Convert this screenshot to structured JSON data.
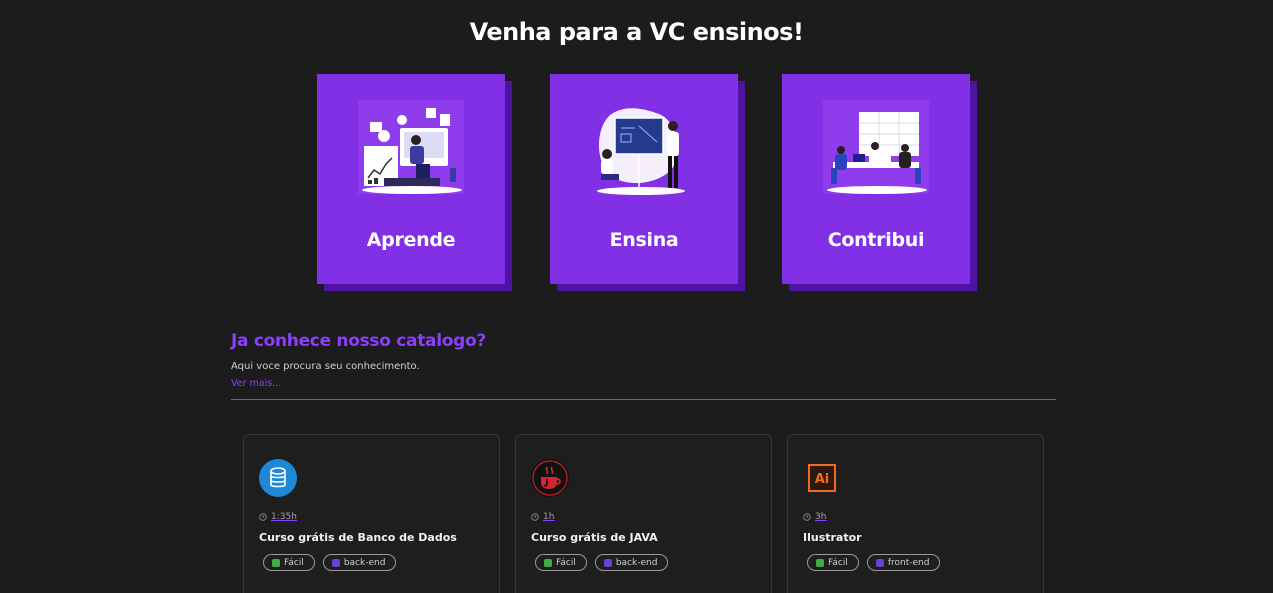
{
  "hero": {
    "title": "Venha para a VC ensinos!"
  },
  "features": [
    {
      "label": "Aprende"
    },
    {
      "label": "Ensina"
    },
    {
      "label": "Contribui"
    }
  ],
  "catalog": {
    "title": "Ja conhece nosso catalogo?",
    "subtitle": "Aqui voce procura seu conhecimento.",
    "link": "Ver mais..."
  },
  "courses": [
    {
      "icon": "database-icon",
      "duration": "1:35h",
      "title": "Curso grátis de Banco de Dados",
      "tags": [
        {
          "label": "Fácil",
          "icon": "level-icon"
        },
        {
          "label": "back-end",
          "icon": "area-icon"
        }
      ]
    },
    {
      "icon": "java-icon",
      "duration": "1h",
      "title": "Curso grátis de JAVA",
      "tags": [
        {
          "label": "Fácil",
          "icon": "level-icon"
        },
        {
          "label": "back-end",
          "icon": "area-icon"
        }
      ]
    },
    {
      "icon": "illustrator-icon",
      "duration": "3h",
      "title": "Ilustrator",
      "tags": [
        {
          "label": "Fácil",
          "icon": "level-icon"
        },
        {
          "label": "front-end",
          "icon": "area-icon"
        }
      ]
    }
  ],
  "colors": {
    "background": "#1c1c1c",
    "accent": "#8a3ffc",
    "feature_card": "#8230e6",
    "feature_shadow": "#4f12a3",
    "level_tag": "#3fae49",
    "area_tag": "#6b3fd8"
  }
}
